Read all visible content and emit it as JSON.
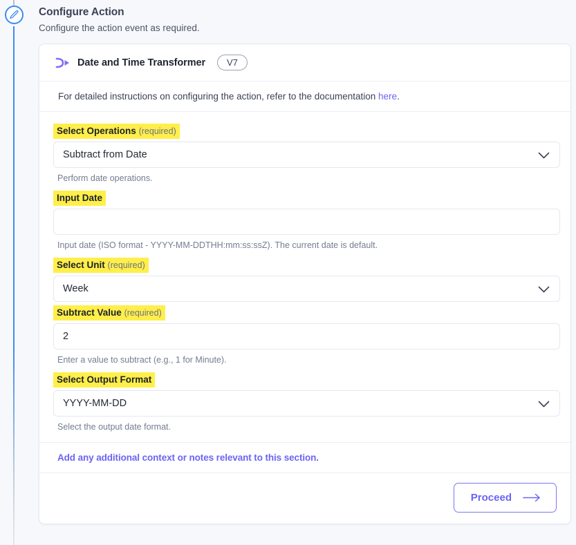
{
  "header": {
    "title": "Configure Action",
    "subtitle": "Configure the action event as required."
  },
  "rail": {
    "node_icon": "pencil-icon",
    "line_color": "#3b8bf0"
  },
  "card": {
    "icon": "transformer-icon",
    "title": "Date and Time Transformer",
    "version_badge": "V7",
    "doc_note_prefix": "For detailed instructions on configuring the action, refer to the documentation ",
    "doc_note_link": "here",
    "doc_note_suffix": ".",
    "link_color": "#6c63f5",
    "highlight_color": "#ffef4a"
  },
  "fields": [
    {
      "label": "Select Operations",
      "required_text": "(required)",
      "type": "select",
      "value": "Subtract from Date",
      "placeholder": "",
      "help": "Perform date operations."
    },
    {
      "label": "Input Date",
      "required_text": "",
      "type": "text",
      "value": "",
      "placeholder": "",
      "help": "Input date (ISO format - YYYY-MM-DDTHH:mm:ss:ssZ). The current date is default."
    },
    {
      "label": "Select Unit",
      "required_text": "(required)",
      "type": "select",
      "value": "Week",
      "placeholder": "",
      "help": ""
    },
    {
      "label": "Subtract Value",
      "required_text": "(required)",
      "type": "text",
      "value": "2",
      "placeholder": "",
      "help": "Enter a value to subtract (e.g., 1 for Minute)."
    },
    {
      "label": "Select Output Format",
      "required_text": "",
      "type": "select",
      "value": "YYYY-MM-DD",
      "placeholder": "",
      "help": "Select the output date format."
    }
  ],
  "context_note": "Add any additional context or notes relevant to this section.",
  "footer": {
    "proceed_label": "Proceed",
    "proceed_icon": "arrow-right-icon",
    "accent_color": "#6c63f5"
  }
}
